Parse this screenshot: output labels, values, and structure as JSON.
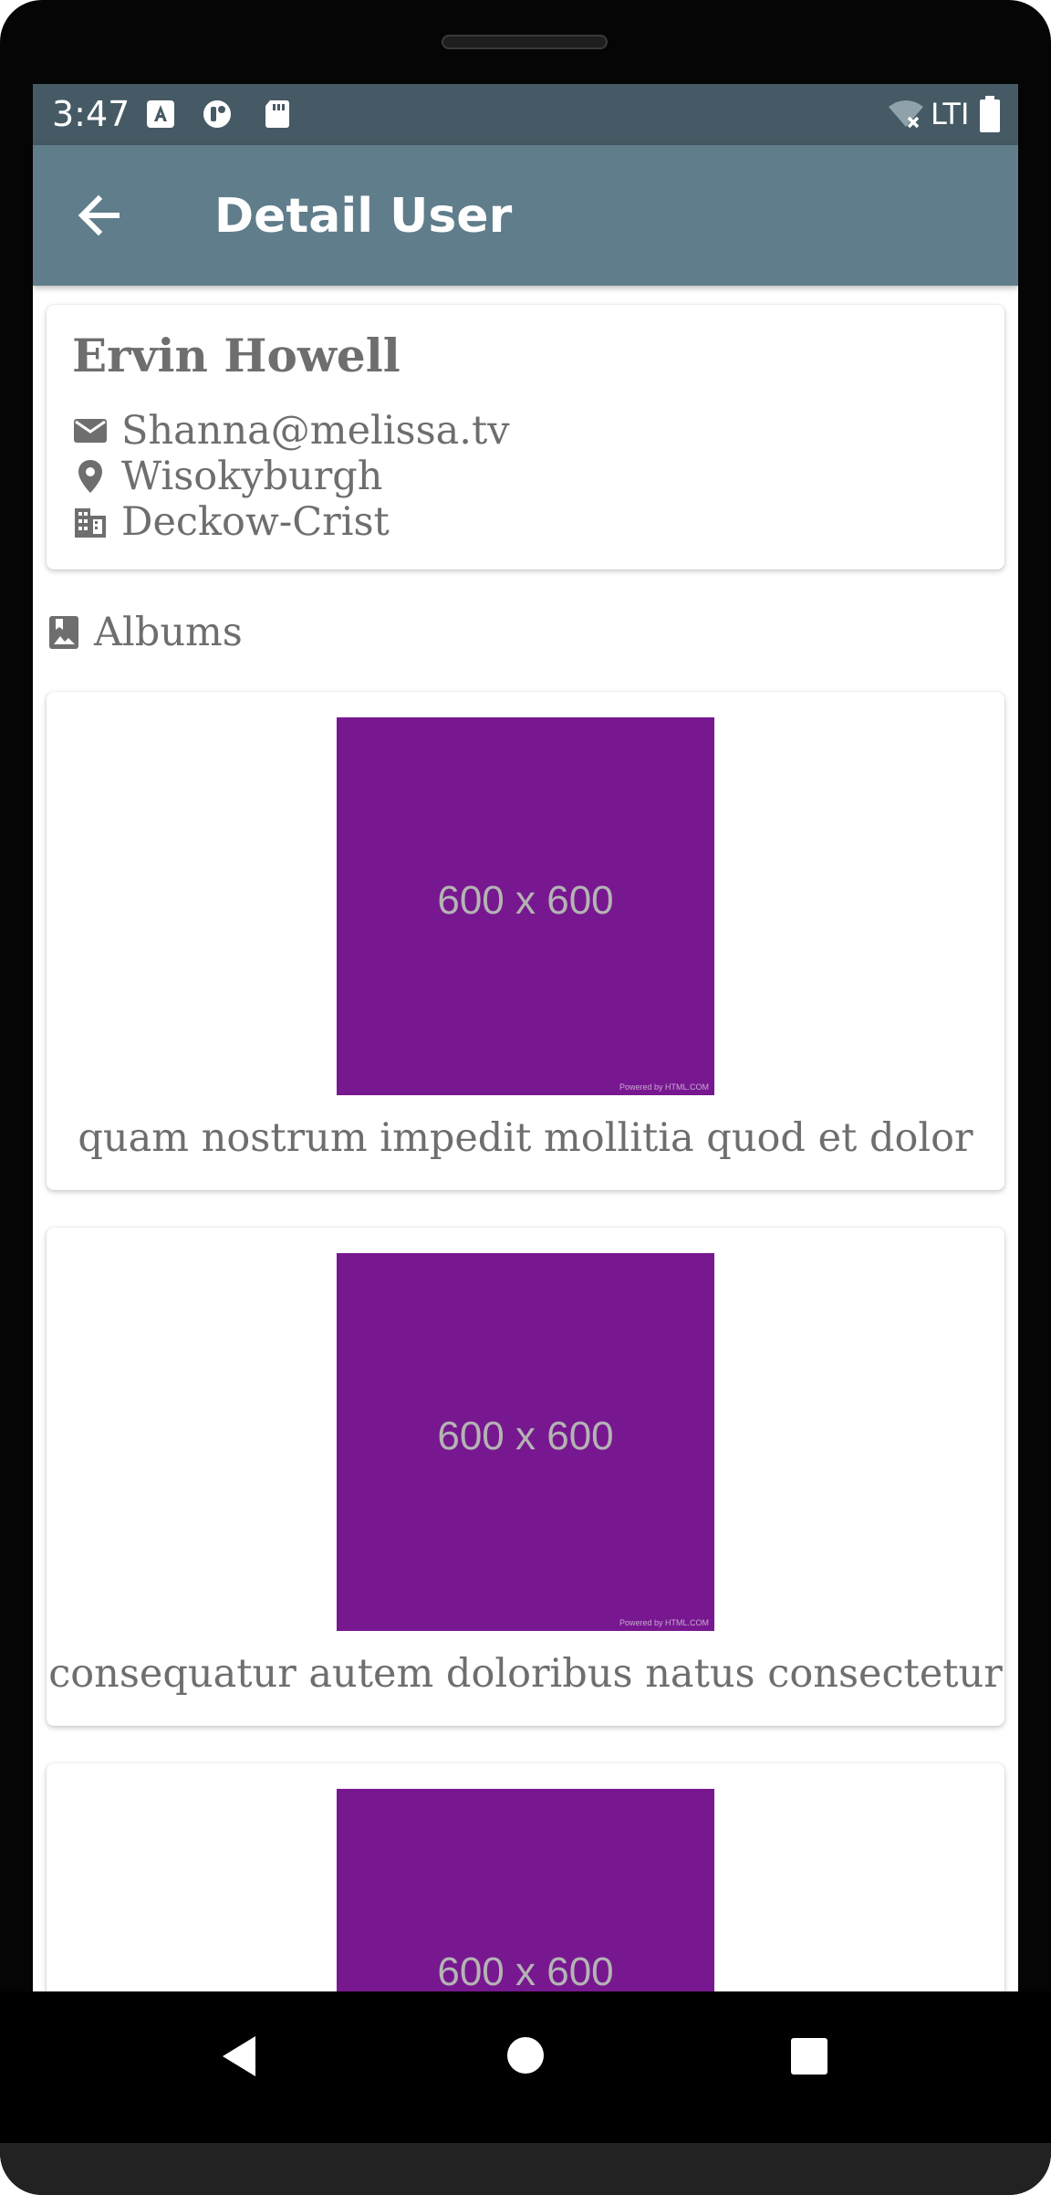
{
  "status_bar": {
    "time": "3:47",
    "network": "LTI",
    "icons": [
      "a-accessibility-icon",
      "circle-notification-icon",
      "sd-card-icon",
      "wifi-off-icon",
      "battery-icon"
    ]
  },
  "app_bar": {
    "title": "Detail User",
    "back_icon": "arrow-back-icon"
  },
  "user": {
    "name": "Ervin Howell",
    "email": "Shanna@melissa.tv",
    "city": "Wisokyburgh",
    "company": "Deckow-Crist"
  },
  "albums_section": {
    "title": "Albums",
    "icon": "photo-album-icon"
  },
  "albums": [
    {
      "title": "quam nostrum impedit mollitia quod et dolor",
      "thumb_label": "600 x 600",
      "thumb_footer": "Powered by HTML.COM",
      "thumb_color": "#781890"
    },
    {
      "title": "consequatur autem doloribus natus consectetur",
      "thumb_label": "600 x 600",
      "thumb_footer": "Powered by HTML.COM",
      "thumb_color": "#781890"
    },
    {
      "title": "",
      "thumb_label": "600 x 600",
      "thumb_footer": "",
      "thumb_color": "#781890"
    }
  ],
  "nav_bar": {
    "buttons": [
      "back-triangle-icon",
      "home-circle-icon",
      "recents-square-icon"
    ]
  },
  "colors": {
    "status_bar": "#455a64",
    "app_bar": "#607d8b",
    "text_grey": "#6e6e6e",
    "thumb_purple": "#781890"
  }
}
